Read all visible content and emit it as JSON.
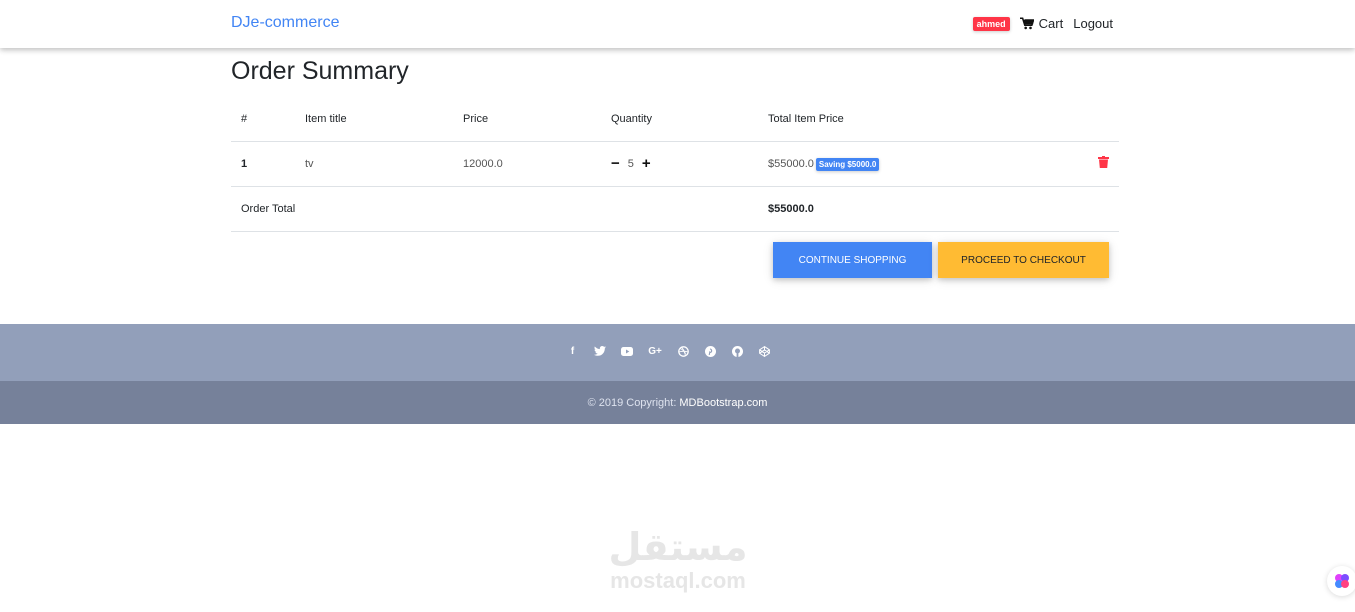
{
  "navbar": {
    "brand": "DJe-commerce",
    "user": "ahmed",
    "cart_label": "Cart",
    "logout_label": "Logout"
  },
  "page": {
    "title": "Order Summary"
  },
  "table": {
    "headers": [
      "#",
      "Item title",
      "Price",
      "Quantity",
      "Total Item Price"
    ],
    "rows": [
      {
        "num": "1",
        "title": "tv",
        "price": "12000.0",
        "quantity": "5",
        "total": "$55000.0",
        "saving": "Saving $5000.0"
      }
    ],
    "order_total_label": "Order Total",
    "order_total_value": "$55000.0"
  },
  "actions": {
    "continue_label": "CONTINUE SHOPPING",
    "checkout_label": "PROCEED TO CHECKOUT"
  },
  "footer": {
    "copyright": "© 2019 Copyright:",
    "link": "MDBootstrap.com",
    "social_icons": [
      "facebook-icon",
      "twitter-icon",
      "youtube-icon",
      "google-plus-icon",
      "dribbble-icon",
      "pinterest-icon",
      "github-icon",
      "codepen-icon"
    ]
  },
  "watermark": {
    "arabic": "مستقل",
    "latin": "mostaql.com"
  },
  "colors": {
    "primary": "#4285f4",
    "danger": "#ff3547",
    "warning": "#ffbb33",
    "footer_top": "#929fba",
    "footer_bottom": "#76819a"
  }
}
